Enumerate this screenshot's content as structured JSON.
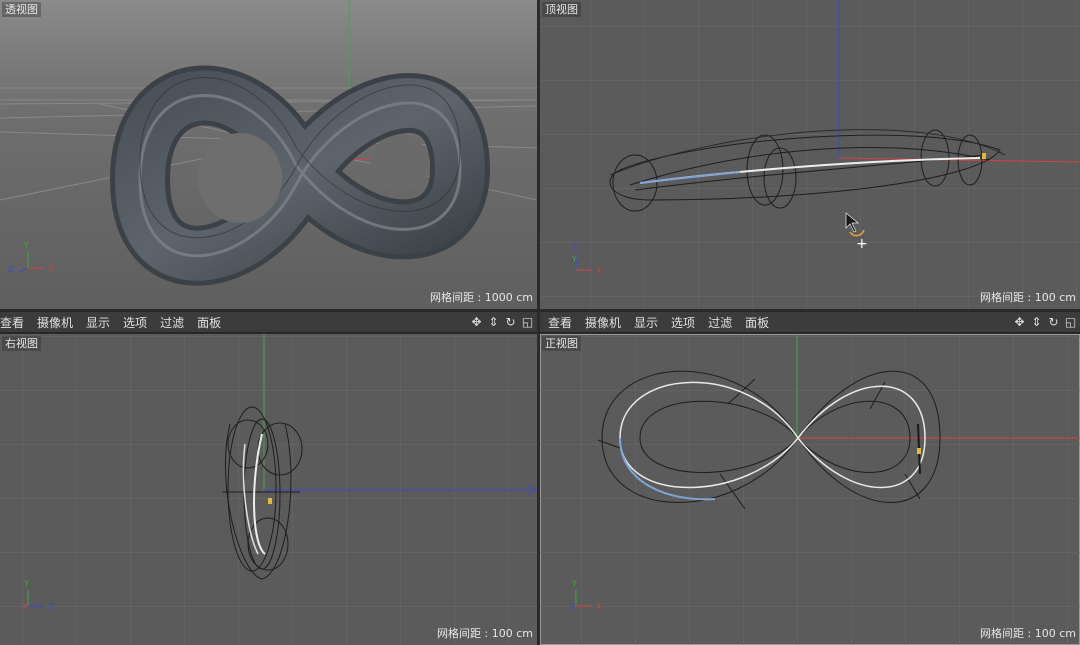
{
  "viewports": {
    "perspective": {
      "title": "透视图",
      "grid_label": "网格间距 : 1000 cm"
    },
    "top": {
      "title": "顶视图",
      "grid_label": "网格间距 : 100 cm"
    },
    "right": {
      "title": "右视图",
      "grid_label": "网格间距 : 100 cm"
    },
    "front": {
      "title": "正视图",
      "grid_label": "网格间距 : 100 cm"
    }
  },
  "menu_left": {
    "view": "查看",
    "camera": "摄像机",
    "display": "显示",
    "options": "选项",
    "filter": "过滤",
    "panel": "面板"
  },
  "menu_right": {
    "view": "查看",
    "camera": "摄像机",
    "display": "显示",
    "options": "选项",
    "filter": "过滤",
    "panel": "面板"
  },
  "axis_labels": {
    "x": "X",
    "y": "Y",
    "z": "Z"
  },
  "icons": [
    "move-view-icon",
    "dolly-view-icon",
    "rotate-view-icon",
    "toggle-layout-icon"
  ],
  "colors": {
    "x_axis": "#d94040",
    "y_axis": "#3fa83f",
    "z_axis": "#3c4ad0",
    "grid": "#6b6b6b",
    "viewport_bg": "#5b5b5b"
  }
}
